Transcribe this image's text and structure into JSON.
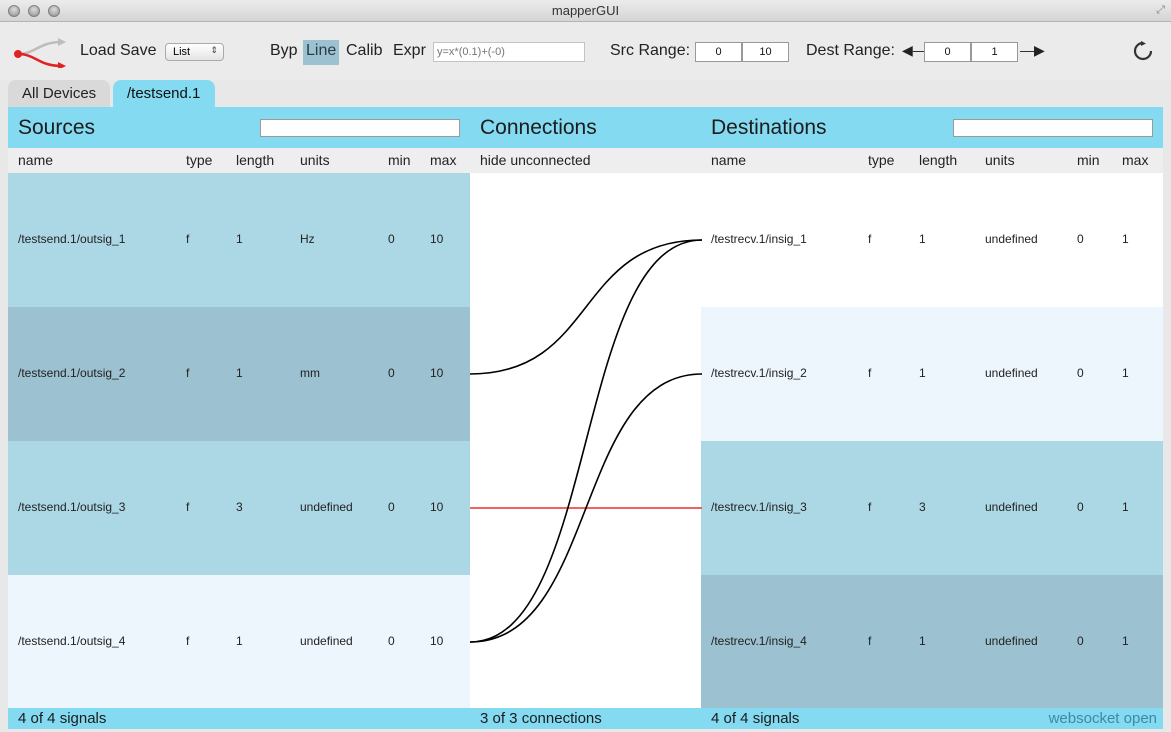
{
  "window": {
    "title": "mapperGUI"
  },
  "toolbar": {
    "load_label": "Load",
    "save_label": "Save",
    "view_select": "List",
    "modes": [
      "Byp",
      "Line",
      "Calib",
      "Expr"
    ],
    "active_mode": "Line",
    "expr_placeholder": "y=x*(0.1)+(-0)",
    "src_range_label": "Src Range:",
    "src_range_min": "0",
    "src_range_max": "10",
    "dest_range_label": "Dest Range:",
    "dest_range_min": "0",
    "dest_range_max": "1"
  },
  "tabs": [
    "All Devices",
    "/testsend.1"
  ],
  "active_tab": "/testsend.1",
  "sources": {
    "title": "Sources",
    "columns": [
      "name",
      "type",
      "length",
      "units",
      "min",
      "max"
    ],
    "rows": [
      {
        "name": "/testsend.1/outsig_1",
        "type": "f",
        "length": "1",
        "units": "Hz",
        "min": "0",
        "max": "10",
        "bg": "#acd8e5"
      },
      {
        "name": "/testsend.1/outsig_2",
        "type": "f",
        "length": "1",
        "units": "mm",
        "min": "0",
        "max": "10",
        "bg": "#9cc1d0"
      },
      {
        "name": "/testsend.1/outsig_3",
        "type": "f",
        "length": "3",
        "units": "undefined",
        "min": "0",
        "max": "10",
        "bg": "#acd8e5"
      },
      {
        "name": "/testsend.1/outsig_4",
        "type": "f",
        "length": "1",
        "units": "undefined",
        "min": "0",
        "max": "10",
        "bg": "#edf5fd"
      }
    ],
    "footer": "4 of 4 signals"
  },
  "connections": {
    "title": "Connections",
    "header": "hide unconnected",
    "footer": "3 of 3 connections",
    "links": [
      {
        "from": 2,
        "to": 1,
        "color": "#000000"
      },
      {
        "from": 3,
        "to": 3,
        "color": "#e8322a"
      },
      {
        "from": 4,
        "to": 1,
        "color": "#000000"
      },
      {
        "from": 4,
        "to": 2,
        "color": "#000000"
      }
    ]
  },
  "destinations": {
    "title": "Destinations",
    "columns": [
      "name",
      "type",
      "length",
      "units",
      "min",
      "max"
    ],
    "rows": [
      {
        "name": "/testrecv.1/insig_1",
        "type": "f",
        "length": "1",
        "units": "undefined",
        "min": "0",
        "max": "1",
        "bg": "#ffffff"
      },
      {
        "name": "/testrecv.1/insig_2",
        "type": "f",
        "length": "1",
        "units": "undefined",
        "min": "0",
        "max": "1",
        "bg": "#edf5fd"
      },
      {
        "name": "/testrecv.1/insig_3",
        "type": "f",
        "length": "3",
        "units": "undefined",
        "min": "0",
        "max": "1",
        "bg": "#acd8e5"
      },
      {
        "name": "/testrecv.1/insig_4",
        "type": "f",
        "length": "1",
        "units": "undefined",
        "min": "0",
        "max": "1",
        "bg": "#9cc1d0"
      }
    ],
    "footer": "4 of 4 signals"
  },
  "status": "websocket open",
  "colors": {
    "accent": "#83daf1",
    "selected_mode": "#9cc1d1",
    "highlight_link": "#e8322a"
  }
}
